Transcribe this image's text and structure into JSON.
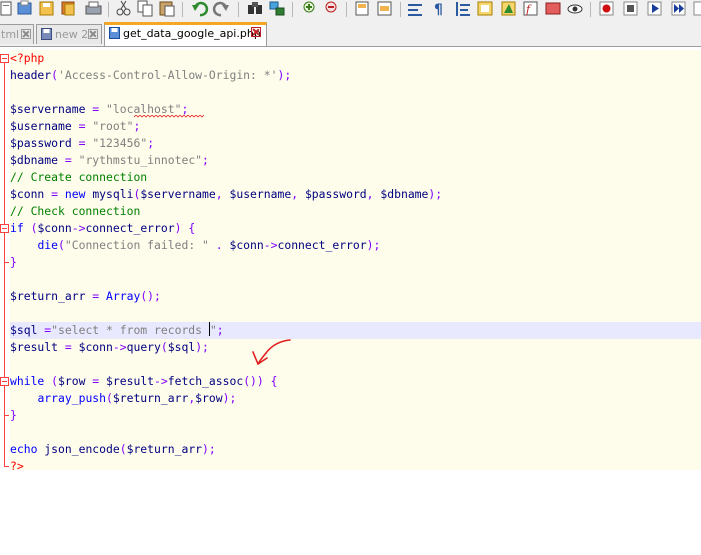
{
  "toolbar": {
    "buttons": [
      "new-file-icon",
      "open-file-icon",
      "save-icon",
      "save-all-icon",
      "close-icon",
      "close-all-icon",
      "print-icon",
      "cut-icon",
      "copy-icon",
      "paste-icon",
      "undo-icon",
      "redo-icon",
      "find-icon",
      "replace-icon",
      "zoom-in-icon",
      "zoom-out-icon",
      "sync-vertical-icon",
      "sync-horizontal-icon",
      "word-wrap-icon",
      "show-all-chars-icon",
      "indent-guide-icon",
      "language-icon",
      "document-map-icon",
      "function-list-icon",
      "folder-workspace-icon",
      "monitoring-icon",
      "record-macro-icon",
      "stop-macro-icon",
      "play-macro-icon",
      "run-macro-icon",
      "save-macro-icon"
    ]
  },
  "tabs": [
    {
      "label": "tml",
      "active": false
    },
    {
      "label": "new 2",
      "active": false
    },
    {
      "label": "get_data_google_api.php",
      "active": true
    }
  ],
  "code": {
    "lines": [
      [
        [
          "tag",
          "<?php"
        ]
      ],
      [
        [
          "fn",
          "header"
        ],
        [
          "op",
          "("
        ],
        [
          "str",
          "'Access-Control-Allow-Origin: *'"
        ],
        [
          "op",
          ");"
        ]
      ],
      [],
      [
        [
          "var",
          "$servername"
        ],
        [
          "op",
          " = "
        ],
        [
          "str",
          "\"localhost\""
        ],
        [
          "op",
          ";"
        ]
      ],
      [
        [
          "var",
          "$username"
        ],
        [
          "op",
          " = "
        ],
        [
          "str",
          "\"root\""
        ],
        [
          "op",
          ";"
        ]
      ],
      [
        [
          "var",
          "$password"
        ],
        [
          "op",
          " = "
        ],
        [
          "str",
          "\"123456\""
        ],
        [
          "op",
          ";"
        ]
      ],
      [
        [
          "var",
          "$dbname"
        ],
        [
          "op",
          " = "
        ],
        [
          "str",
          "\"rythmstu_innotec\""
        ],
        [
          "op",
          ";"
        ]
      ],
      [
        [
          "cm",
          "// Create connection"
        ]
      ],
      [
        [
          "var",
          "$conn"
        ],
        [
          "op",
          " = "
        ],
        [
          "kw",
          "new "
        ],
        [
          "fn",
          "mysqli"
        ],
        [
          "op",
          "("
        ],
        [
          "var",
          "$servername"
        ],
        [
          "op",
          ", "
        ],
        [
          "var",
          "$username"
        ],
        [
          "op",
          ", "
        ],
        [
          "var",
          "$password"
        ],
        [
          "op",
          ", "
        ],
        [
          "var",
          "$dbname"
        ],
        [
          "op",
          ");"
        ]
      ],
      [
        [
          "cm",
          "// Check connection"
        ]
      ],
      [
        [
          "kw",
          "if "
        ],
        [
          "op",
          "("
        ],
        [
          "var",
          "$conn"
        ],
        [
          "op",
          "->"
        ],
        [
          "fn",
          "connect_error"
        ],
        [
          "op",
          ") {"
        ]
      ],
      [
        [
          "op",
          "    "
        ],
        [
          "kw",
          "die"
        ],
        [
          "op",
          "("
        ],
        [
          "str",
          "\"Connection failed: \""
        ],
        [
          "op",
          " . "
        ],
        [
          "var",
          "$conn"
        ],
        [
          "op",
          "->"
        ],
        [
          "fn",
          "connect_error"
        ],
        [
          "op",
          ");"
        ]
      ],
      [
        [
          "op",
          "}"
        ]
      ],
      [],
      [
        [
          "var",
          "$return_arr"
        ],
        [
          "op",
          " = "
        ],
        [
          "kw",
          "Array"
        ],
        [
          "op",
          "();"
        ]
      ],
      [],
      [
        [
          "var",
          "$sql"
        ],
        [
          "op",
          " ="
        ],
        [
          "str",
          "\"select * from records "
        ],
        [
          "caret",
          ""
        ],
        [
          "str",
          "\""
        ],
        [
          "op",
          ";"
        ]
      ],
      [
        [
          "var",
          "$result"
        ],
        [
          "op",
          " = "
        ],
        [
          "var",
          "$conn"
        ],
        [
          "op",
          "->"
        ],
        [
          "fn",
          "query"
        ],
        [
          "op",
          "("
        ],
        [
          "var",
          "$sql"
        ],
        [
          "op",
          ");"
        ]
      ],
      [],
      [
        [
          "kw",
          "while "
        ],
        [
          "op",
          "("
        ],
        [
          "var",
          "$row"
        ],
        [
          "op",
          " = "
        ],
        [
          "var",
          "$result"
        ],
        [
          "op",
          "->"
        ],
        [
          "fn",
          "fetch_assoc"
        ],
        [
          "op",
          "()) {"
        ]
      ],
      [
        [
          "op",
          "    "
        ],
        [
          "kw",
          "array_push"
        ],
        [
          "op",
          "("
        ],
        [
          "var",
          "$return_arr"
        ],
        [
          "op",
          ","
        ],
        [
          "var",
          "$row"
        ],
        [
          "op",
          ");"
        ]
      ],
      [
        [
          "op",
          "}"
        ]
      ],
      [],
      [
        [
          "kw",
          "echo "
        ],
        [
          "fn",
          "json_encode"
        ],
        [
          "op",
          "("
        ],
        [
          "var",
          "$return_arr"
        ],
        [
          "op",
          ");"
        ]
      ],
      [
        [
          "tag",
          "?>"
        ]
      ]
    ],
    "current_line": 16
  },
  "colors": {
    "editor_bg": "#fefcea",
    "current_line_bg": "#e8e8ff",
    "keyword": "#0000ff",
    "variable": "#000080",
    "string": "#808080",
    "comment": "#008000",
    "php_tag": "#ff0000",
    "annotation_arrow": "#e02020"
  }
}
